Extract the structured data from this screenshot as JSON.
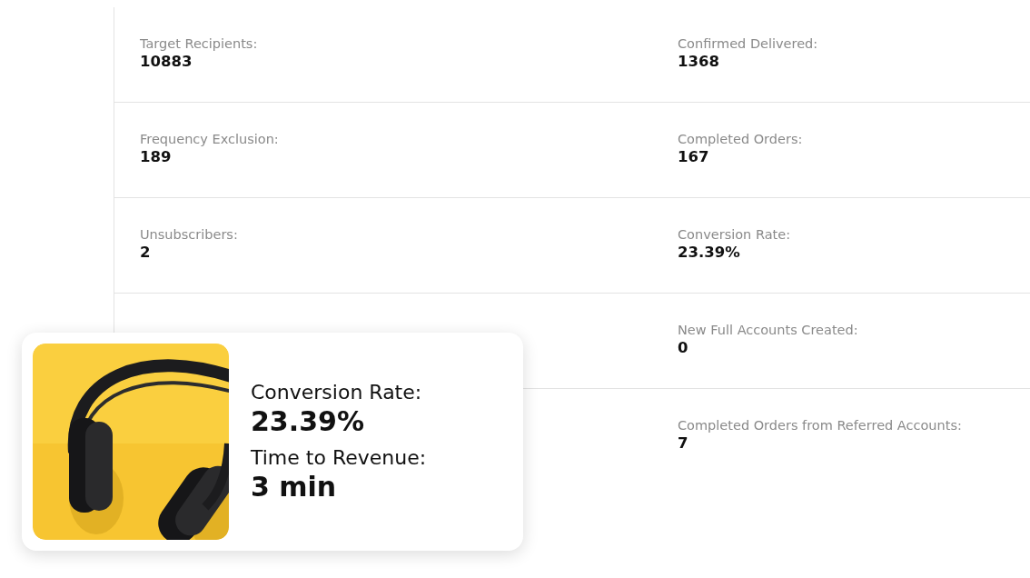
{
  "rows": [
    {
      "left": {
        "label": "Target Recipients:",
        "value": "10883"
      },
      "right": {
        "label": "Confirmed Delivered:",
        "value": "1368"
      }
    },
    {
      "left": {
        "label": "Frequency Exclusion:",
        "value": "189"
      },
      "right": {
        "label": "Completed Orders:",
        "value": "167"
      }
    },
    {
      "left": {
        "label": "Unsubscribers:",
        "value": "2"
      },
      "right": {
        "label": "Conversion Rate:",
        "value": "23.39%"
      }
    },
    {
      "right": {
        "label": "New Full Accounts Created:",
        "value": "0"
      }
    },
    {
      "right": {
        "label": "Completed Orders from Referred Accounts:",
        "value": "7"
      }
    }
  ],
  "highlight_card": {
    "stats": [
      {
        "label": "Conversion Rate:",
        "value": "23.39%"
      },
      {
        "label": "Time to Revenue:",
        "value": "3 min"
      }
    ]
  }
}
